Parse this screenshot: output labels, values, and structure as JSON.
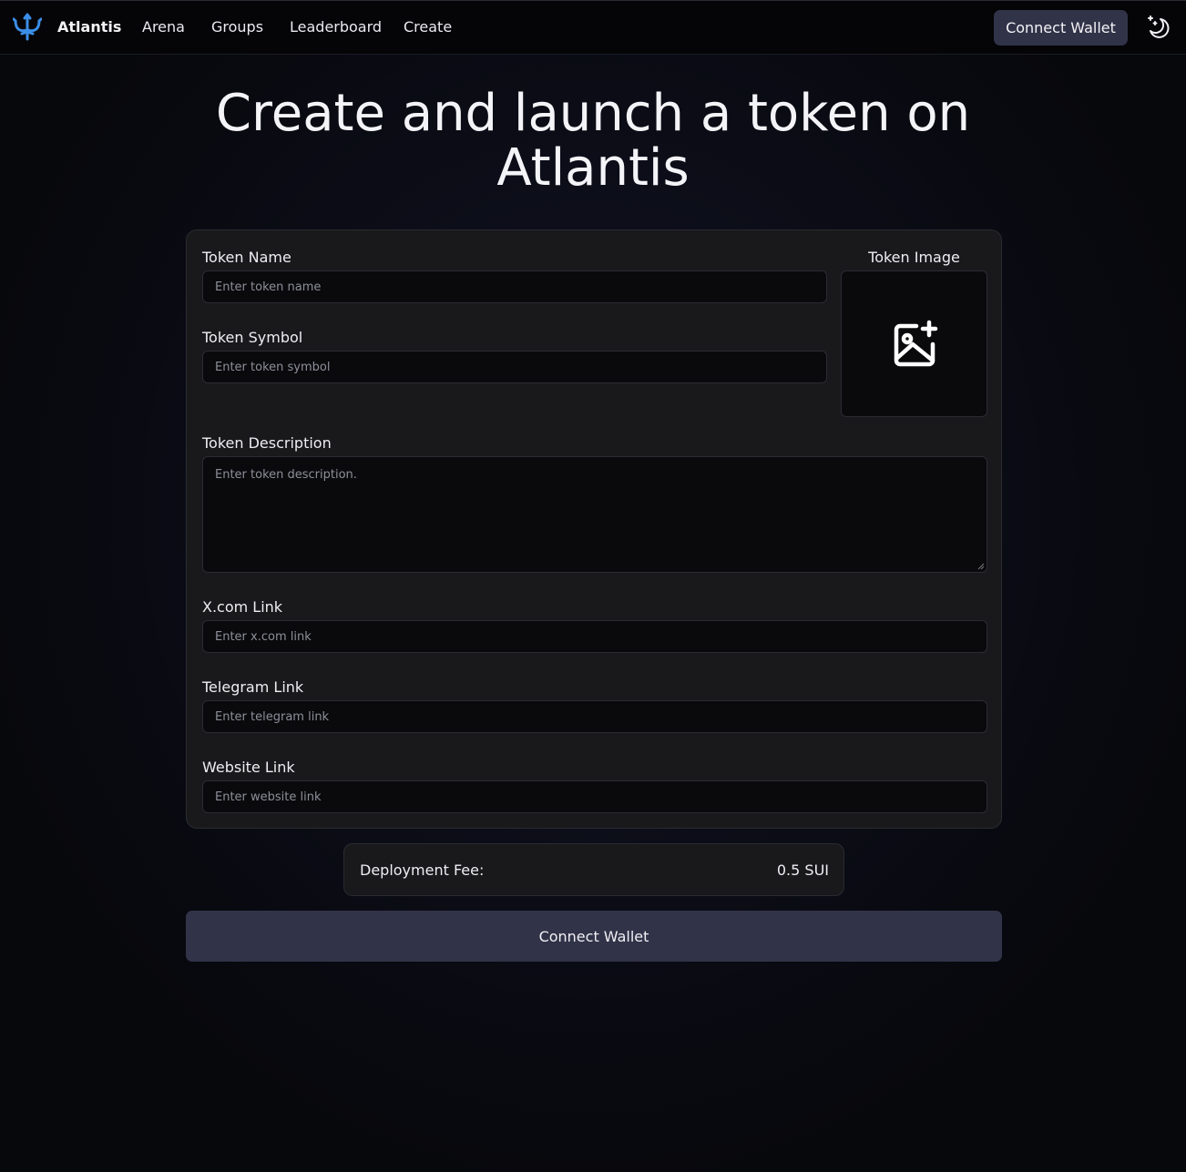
{
  "nav": {
    "brand": "Atlantis",
    "links": [
      "Arena",
      "Groups",
      "Leaderboard",
      "Create"
    ],
    "connect_wallet": "Connect Wallet",
    "logo_icon": "trident-icon",
    "theme_icon": "moon-stars-icon"
  },
  "page": {
    "title_line1": "Create and launch a token on",
    "title_line2": "Atlantis"
  },
  "form": {
    "token_name": {
      "label": "Token Name",
      "placeholder": "Enter token name"
    },
    "token_symbol": {
      "label": "Token Symbol",
      "placeholder": "Enter token symbol"
    },
    "token_image": {
      "label": "Token Image",
      "icon": "image-plus-icon"
    },
    "token_description": {
      "label": "Token Description",
      "placeholder": "Enter token description."
    },
    "x_link": {
      "label": "X.com Link",
      "placeholder": "Enter x.com link"
    },
    "telegram_link": {
      "label": "Telegram Link",
      "placeholder": "Enter telegram link"
    },
    "website_link": {
      "label": "Website Link",
      "placeholder": "Enter website link"
    }
  },
  "fee": {
    "label": "Deployment Fee:",
    "value": "0.5 SUI"
  },
  "submit": {
    "label": "Connect Wallet"
  },
  "colors": {
    "accent_logo": "#3b8ee8",
    "button_bg": "#313348",
    "card_bg": "#19191c"
  }
}
